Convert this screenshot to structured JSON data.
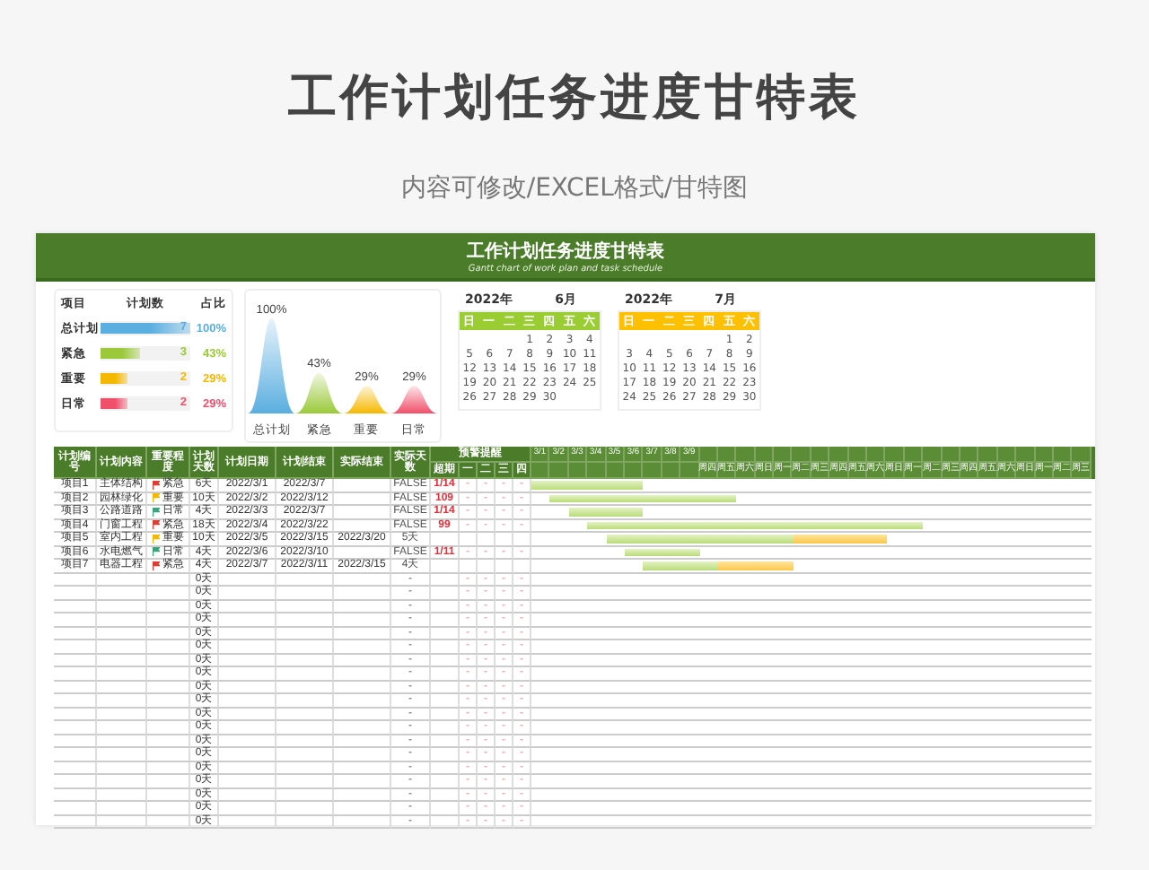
{
  "title": "工作计划任务进度甘特表",
  "subtitle": "内容可修改/EXCEL格式/甘特图",
  "sheet": {
    "title": "工作计划任务进度甘特表",
    "subtitle": "Gantt chart of work plan and task schedule",
    "summary": {
      "headers": [
        "项目",
        "计划数",
        "占比"
      ],
      "items": [
        {
          "label": "总计划",
          "count": "7",
          "percent": "100%",
          "level": 1,
          "color": "#5aaee0"
        },
        {
          "label": "紧急",
          "count": "3",
          "percent": "43%",
          "level": 0.43,
          "color": "#9bc93a"
        },
        {
          "label": "重要",
          "count": "2",
          "percent": "29%",
          "level": 0.29,
          "color": "#f5b800"
        },
        {
          "label": "日常",
          "count": "2",
          "percent": "29%",
          "level": 0.29,
          "color": "#f0506a"
        }
      ]
    },
    "peak_chart": {
      "items": [
        {
          "label": "总计划",
          "value_label": "100%"
        },
        {
          "label": "紧急",
          "value_label": "43%"
        },
        {
          "label": "重要",
          "value_label": "29%"
        },
        {
          "label": "日常",
          "value_label": "29%"
        }
      ]
    },
    "calendars": [
      {
        "year": "2022年",
        "month": "6月",
        "color": "#9acd32",
        "weekdays": [
          "日",
          "一",
          "二",
          "三",
          "四",
          "五",
          "六"
        ],
        "days": [
          "1",
          "2",
          "3",
          "4",
          "5",
          "6",
          "7",
          "8",
          "9",
          "10",
          "11",
          "12",
          "13",
          "14",
          "15",
          "16",
          "17",
          "18",
          "19",
          "20",
          "21",
          "22",
          "23",
          "24",
          "25",
          "26",
          "27",
          "28",
          "29",
          "30"
        ]
      },
      {
        "year": "2022年",
        "month": "7月",
        "color": "#ffc000",
        "weekdays": [
          "日",
          "一",
          "二",
          "三",
          "四",
          "五",
          "六"
        ],
        "days": [
          "1",
          "2",
          "3",
          "4",
          "5",
          "6",
          "7",
          "8",
          "9",
          "10",
          "11",
          "12",
          "13",
          "14",
          "15",
          "16",
          "17",
          "18",
          "19",
          "20",
          "21",
          "22",
          "23",
          "24",
          "25",
          "26",
          "27",
          "28",
          "29",
          "30"
        ]
      }
    ],
    "table": {
      "columns": [
        "计划编号",
        "计划内容",
        "重要程度",
        "计划天数",
        "计划日期",
        "计划结束",
        "实际结束",
        "实际天数"
      ],
      "warning_header": "预警提醒",
      "warning_columns": [
        "超期",
        "一",
        "二",
        "三",
        "四"
      ],
      "gantt_columns": [
        {
          "date": "3/1"
        },
        {
          "date": "3/2"
        },
        {
          "date": "3/3"
        },
        {
          "date": "3/4"
        },
        {
          "date": "3/5"
        },
        {
          "date": "3/6"
        },
        {
          "date": "3/7"
        },
        {
          "date": "3/8"
        },
        {
          "date": "3/9"
        },
        {
          "weekday": "周四"
        },
        {
          "weekday": "周五"
        },
        {
          "weekday": "周六"
        },
        {
          "weekday": "周日"
        },
        {
          "weekday": "周一"
        },
        {
          "weekday": "周二"
        },
        {
          "weekday": "周三"
        },
        {
          "weekday": "周四"
        },
        {
          "weekday": "周五"
        },
        {
          "weekday": "周六"
        },
        {
          "weekday": "周日"
        },
        {
          "weekday": "周一"
        },
        {
          "weekday": "周二"
        },
        {
          "weekday": "周三"
        },
        {
          "weekday": "周四"
        },
        {
          "weekday": "周五"
        },
        {
          "weekday": "周六"
        },
        {
          "weekday": "周日"
        },
        {
          "weekday": "周一"
        },
        {
          "weekday": "周二"
        },
        {
          "weekday": "周三"
        }
      ],
      "rows": [
        {
          "id": "项目1",
          "content": "主体结构",
          "priority": "紧急",
          "color": "#e03c31",
          "days": "6天",
          "start": "2022/3/1",
          "end": "2022/3/7",
          "actual": "FALSE",
          "warnings": [
            "1/14",
            "-",
            "-",
            "-",
            "-"
          ]
        },
        {
          "id": "项目2",
          "content": "园林绿化",
          "priority": "重要",
          "color": "#f5b800",
          "days": "10天",
          "start": "2022/3/2",
          "end": "2022/3/12",
          "actual": "FALSE",
          "warnings": [
            "109",
            "-",
            "-",
            "-",
            "-"
          ]
        },
        {
          "id": "项目3",
          "content": "公路道路",
          "priority": "日常",
          "color": "#3aa57a",
          "days": "4天",
          "start": "2022/3/3",
          "end": "2022/3/7",
          "actual": "FALSE",
          "warnings": [
            "1/14",
            "-",
            "-",
            "-",
            "-"
          ]
        },
        {
          "id": "项目4",
          "content": "门窗工程",
          "priority": "紧急",
          "color": "#e03c31",
          "days": "18天",
          "start": "2022/3/4",
          "end": "2022/3/22",
          "actual": "FALSE",
          "warnings": [
            "99",
            "-",
            "-",
            "-",
            "-"
          ]
        },
        {
          "id": "项目5",
          "content": "室内工程",
          "priority": "重要",
          "color": "#f5b800",
          "days": "10天",
          "start": "2022/3/5",
          "end": "2022/3/15",
          "actual_end": "2022/3/20",
          "actual": "5天"
        },
        {
          "id": "项目6",
          "content": "水电燃气",
          "priority": "日常",
          "color": "#3aa57a",
          "days": "4天",
          "start": "2022/3/6",
          "end": "2022/3/10",
          "actual": "FALSE",
          "warnings": [
            "1/11",
            "-",
            "-",
            "-",
            "-"
          ]
        },
        {
          "id": "项目7",
          "content": "电器工程",
          "priority": "紧急",
          "color": "#e03c31",
          "days": "4天",
          "start": "2022/3/7",
          "end": "2022/3/11",
          "actual_end": "2022/3/15",
          "actual": "4天"
        },
        {
          "days": "0天",
          "actual": "-",
          "blank_warnings": [
            "-",
            "-",
            "-",
            "-"
          ]
        },
        {
          "days": "0天",
          "actual": "-",
          "blank_warnings": [
            "-",
            "-",
            "-",
            "-"
          ]
        },
        {
          "days": "0天",
          "actual": "-",
          "blank_warnings": [
            "-",
            "-",
            "-",
            "-"
          ]
        },
        {
          "days": "0天",
          "actual": "-",
          "blank_warnings": [
            "-",
            "-",
            "-",
            "-"
          ]
        },
        {
          "days": "0天",
          "actual": "-",
          "blank_warnings": [
            "-",
            "-",
            "-",
            "-"
          ]
        },
        {
          "days": "0天",
          "actual": "-",
          "blank_warnings": [
            "-",
            "-",
            "-",
            "-"
          ]
        },
        {
          "days": "0天",
          "actual": "-",
          "blank_warnings": [
            "-",
            "-",
            "-",
            "-"
          ]
        },
        {
          "days": "0天",
          "actual": "-",
          "blank_warnings": [
            "-",
            "-",
            "-",
            "-"
          ]
        },
        {
          "days": "0天",
          "actual": "-",
          "blank_warnings": [
            "-",
            "-",
            "-",
            "-"
          ]
        },
        {
          "days": "0天",
          "actual": "-",
          "blank_warnings": [
            "-",
            "-",
            "-",
            "-"
          ]
        },
        {
          "days": "0天",
          "actual": "-",
          "blank_warnings": [
            "-",
            "-",
            "-",
            "-"
          ]
        },
        {
          "days": "0天",
          "actual": "-",
          "blank_warnings": [
            "-",
            "-",
            "-",
            "-"
          ]
        },
        {
          "days": "0天",
          "actual": "-",
          "blank_warnings": [
            "-",
            "-",
            "-",
            "-"
          ]
        },
        {
          "days": "0天",
          "actual": "-",
          "blank_warnings": [
            "-",
            "-",
            "-",
            "-"
          ]
        },
        {
          "days": "0天",
          "actual": "-",
          "blank_warnings": [
            "-",
            "-",
            "-",
            "-"
          ]
        },
        {
          "days": "0天",
          "actual": "-",
          "blank_warnings": [
            "-",
            "-",
            "-",
            "-"
          ]
        },
        {
          "days": "0天",
          "actual": "-",
          "blank_warnings": [
            "-",
            "-",
            "-",
            "-"
          ]
        },
        {
          "days": "0天",
          "actual": "-",
          "blank_warnings": [
            "-",
            "-",
            "-",
            "-"
          ]
        },
        {
          "days": "0天",
          "actual": "-",
          "blank_warnings": [
            "-",
            "-",
            "-",
            "-"
          ]
        }
      ]
    }
  }
}
